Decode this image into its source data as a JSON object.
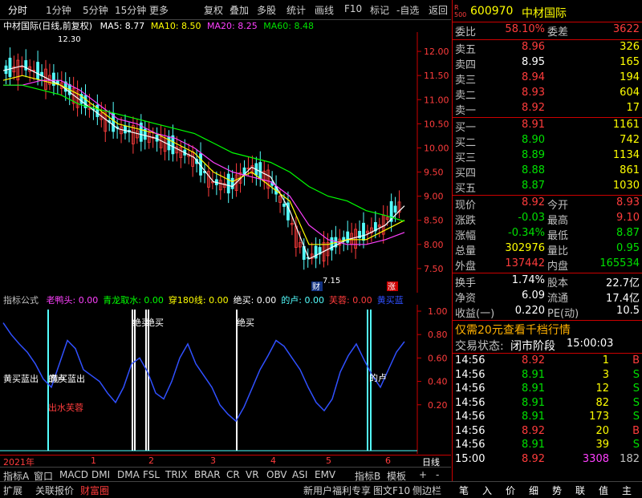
{
  "toolbar": {
    "items": [
      "分时",
      "1分钟",
      "5分钟",
      "15分钟",
      "更多",
      "复权",
      "叠加",
      "多股",
      "统计",
      "画线",
      "F10",
      "标记",
      "-自选",
      "返回"
    ]
  },
  "chart_title": {
    "name": "中材国际(日线,前复权)",
    "ma5": "MA5: 8.77",
    "ma10": "MA10: 8.50",
    "ma20": "MA20: 8.25",
    "ma60": "MA60: 8.48"
  },
  "colors": {
    "ma5": "#ffffff",
    "ma10": "#ffff00",
    "ma20": "#ff40ff",
    "ma60": "#00ff00",
    "up": "#ff3c3c",
    "down": "#54ffff",
    "ind": "#3050ff"
  },
  "price_axis": [
    "12.00",
    "11.50",
    "11.00",
    "10.50",
    "10.00",
    "9.50",
    "9.00",
    "8.50",
    "8.00",
    "7.50"
  ],
  "price_annotations": {
    "high": "12.30",
    "low": "7.15",
    "cai": "财",
    "zhang": "涨"
  },
  "indicator": {
    "title": "指标公式",
    "items": [
      {
        "label": "老鸭头: 0.00",
        "color": "#ff40ff"
      },
      {
        "label": "青龙取水: 0.00",
        "color": "#00ff00"
      },
      {
        "label": "穿180线: 0.00",
        "color": "#ffff00"
      },
      {
        "label": "绝买: 0.00",
        "color": "#ffffff"
      },
      {
        "label": "的卢: 0.00",
        "color": "#54ffff"
      },
      {
        "label": "芙蓉: 0.00",
        "color": "#ff3c3c"
      },
      {
        "label": "黄买蓝",
        "color": "#3050ff"
      }
    ],
    "axis": [
      "1.00",
      "0.80",
      "0.60",
      "0.40",
      "0.20"
    ],
    "texts": [
      "黄买蓝出",
      "的卢",
      "黄买蓝出",
      "出水芙蓉",
      "绝买",
      "绝买",
      "绝买",
      "的卢"
    ]
  },
  "chart_data": {
    "type": "line",
    "title": "中材国际(日线,前复权)",
    "ylim": [
      7.0,
      12.4
    ],
    "series": [
      {
        "name": "MA5",
        "values": [
          11.6,
          11.7,
          11.5,
          11.3,
          11.0,
          10.7,
          10.4,
          10.3,
          10.2,
          10.0,
          9.8,
          9.3,
          9.2,
          9.6,
          9.4,
          8.7,
          7.7,
          7.9,
          8.1,
          8.2,
          8.4,
          8.8
        ]
      },
      {
        "name": "MA10",
        "values": [
          11.4,
          11.5,
          11.4,
          11.3,
          11.1,
          10.8,
          10.5,
          10.4,
          10.3,
          10.1,
          9.9,
          9.5,
          9.3,
          9.5,
          9.2,
          8.9,
          8.0,
          8.0,
          8.1,
          8.1,
          8.3,
          8.5
        ]
      },
      {
        "name": "MA20",
        "values": [
          11.3,
          11.3,
          11.4,
          11.4,
          11.2,
          10.9,
          10.6,
          10.5,
          10.3,
          10.2,
          10.0,
          9.7,
          9.5,
          9.4,
          9.3,
          9.0,
          8.4,
          8.1,
          8.0,
          8.0,
          8.1,
          8.25
        ]
      },
      {
        "name": "MA60",
        "values": [
          11.3,
          11.3,
          11.2,
          11.1,
          10.9,
          10.8,
          10.7,
          10.6,
          10.5,
          10.4,
          10.3,
          10.1,
          9.9,
          9.8,
          9.7,
          9.5,
          9.2,
          9.0,
          8.9,
          8.7,
          8.6,
          8.48
        ]
      }
    ],
    "x_labels": [
      "2021年",
      "1",
      "2",
      "3",
      "4",
      "5",
      "6"
    ]
  },
  "quote": {
    "code": "600970",
    "name": "中材国际",
    "weibi_label": "委比",
    "weibi": "58.10%",
    "weicha_label": "委差",
    "weicha": "3622",
    "asks": [
      {
        "label": "卖五",
        "price": "8.96",
        "vol": "326"
      },
      {
        "label": "卖四",
        "price": "8.95",
        "vol": "165"
      },
      {
        "label": "卖三",
        "price": "8.94",
        "vol": "194"
      },
      {
        "label": "卖二",
        "price": "8.93",
        "vol": "604"
      },
      {
        "label": "卖一",
        "price": "8.92",
        "vol": "17"
      }
    ],
    "bids": [
      {
        "label": "买一",
        "price": "8.91",
        "vol": "1161"
      },
      {
        "label": "买二",
        "price": "8.90",
        "vol": "742"
      },
      {
        "label": "买三",
        "price": "8.89",
        "vol": "1134"
      },
      {
        "label": "买四",
        "price": "8.88",
        "vol": "861"
      },
      {
        "label": "买五",
        "price": "8.87",
        "vol": "1030"
      }
    ],
    "stats": [
      {
        "l1": "现价",
        "v1": "8.92",
        "c1": "#ff3c3c",
        "l2": "今开",
        "v2": "8.93",
        "c2": "#ff3c3c"
      },
      {
        "l1": "涨跌",
        "v1": "-0.03",
        "c1": "#00e000",
        "l2": "最高",
        "v2": "9.10",
        "c2": "#ff3c3c"
      },
      {
        "l1": "涨幅",
        "v1": "-0.34%",
        "c1": "#00e000",
        "l2": "最低",
        "v2": "8.87",
        "c2": "#00e000"
      },
      {
        "l1": "总量",
        "v1": "302976",
        "c1": "#ffff00",
        "l2": "量比",
        "v2": "0.95",
        "c2": "#00e000"
      },
      {
        "l1": "外盘",
        "v1": "137442",
        "c1": "#ff3c3c",
        "l2": "内盘",
        "v2": "165534",
        "c2": "#00e000"
      }
    ],
    "stats2": [
      {
        "l1": "换手",
        "v1": "1.74%",
        "l2": "股本",
        "v2": "22.7亿"
      },
      {
        "l1": "净资",
        "v1": "6.09",
        "l2": "流通",
        "v2": "17.4亿"
      },
      {
        "l1": "收益(一)",
        "v1": "0.220",
        "l2": "PE(动)",
        "v2": "10.5"
      }
    ],
    "promo": "仅需20元查看千档行情",
    "status_label": "交易状态:",
    "status": "闭市阶段",
    "status_time": "15:00:03",
    "ticks": [
      {
        "t": "14:56",
        "p": "8.92",
        "v": "1",
        "s": "B"
      },
      {
        "t": "14:56",
        "p": "8.91",
        "v": "3",
        "s": "S"
      },
      {
        "t": "14:56",
        "p": "8.91",
        "v": "12",
        "s": "S"
      },
      {
        "t": "14:56",
        "p": "8.91",
        "v": "82",
        "s": "S"
      },
      {
        "t": "14:56",
        "p": "8.91",
        "v": "173",
        "s": "S"
      },
      {
        "t": "14:56",
        "p": "8.92",
        "v": "20",
        "s": "B"
      },
      {
        "t": "14:56",
        "p": "8.91",
        "v": "39",
        "s": "S"
      },
      {
        "t": "15:00",
        "p": "8.92",
        "v": "3308",
        "s": "182"
      }
    ]
  },
  "tabs": [
    "指标A",
    "窗口",
    "MACD",
    "DMI",
    "DMA",
    "FSL",
    "TRIX",
    "BRAR",
    "CR",
    "VR",
    "OBV",
    "ASI",
    "EMV",
    "指标B",
    "模板",
    "+",
    "-"
  ],
  "period_label": "日线",
  "bottombar": {
    "left": [
      "扩展",
      "关联报价",
      "财富圈"
    ],
    "right": [
      "新用户福利专享",
      "图文F10",
      "侧边栏"
    ],
    "right_icons": [
      "笔",
      "入",
      "价",
      "细",
      "势",
      "联",
      "值",
      "主"
    ]
  }
}
